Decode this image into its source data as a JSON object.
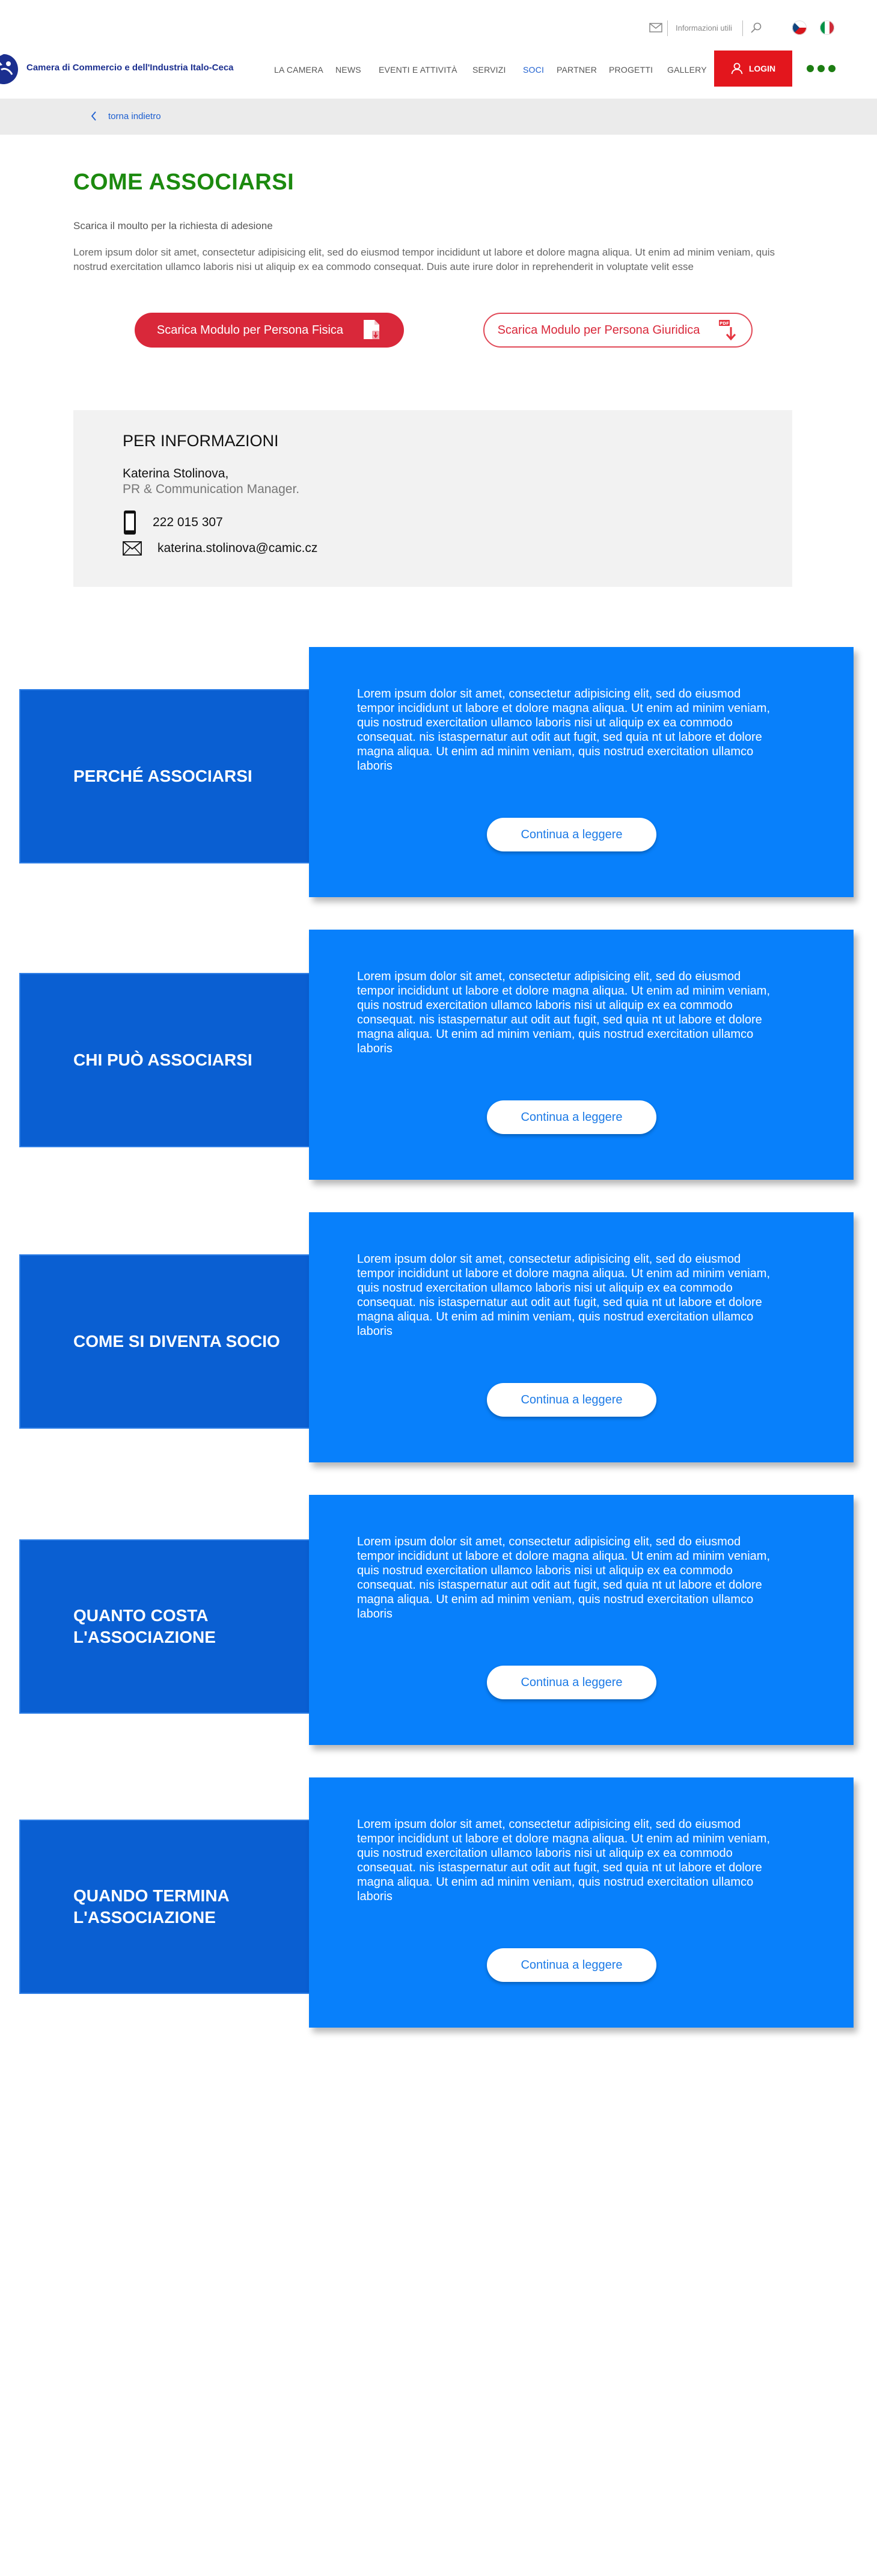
{
  "utility": {
    "info_label": "Informazioni utili",
    "icons": [
      "mail-icon",
      "search-icon",
      "flag-cz-icon",
      "flag-it-icon"
    ]
  },
  "header": {
    "org_name": "Camera di Commercio e dell'Industria Italo-Ceca",
    "nav": [
      "LA CAMERA",
      "NEWS",
      "EVENTI E ATTIVITÀ",
      "SERVIZI",
      "SOCI",
      "PARTNER",
      "PROGETTI",
      "GALLERY"
    ],
    "active_nav": "SOCI",
    "login_label": "LOGIN"
  },
  "breadcrumb": {
    "back_label": "torna indietro"
  },
  "intro": {
    "title": "COME ASSOCIARSI",
    "subtitle": "Scarica il moulto per la richiesta di adesione",
    "body": "Lorem ipsum dolor sit amet, consectetur adipisicing elit, sed do eiusmod tempor incididunt ut labore et dolore magna aliqua. Ut enim ad minim veniam, quis nostrud exercitation ullamco laboris nisi ut aliquip ex ea commodo consequat. Duis aute irure dolor in reprehenderit in voluptate velit esse",
    "download_fisica": "Scarica Modulo per Persona Fisica",
    "download_giuridica": "Scarica Modulo per Persona Giuridica"
  },
  "contact": {
    "title": "PER INFORMAZIONI",
    "name": "Katerina Stolinova,",
    "role": "PR & Communication Manager.",
    "phone": "222 015 307",
    "email": "katerina.stolinova@camic.cz"
  },
  "sections": [
    {
      "label": "PERCHÉ ASSOCIARSI",
      "text": "Lorem ipsum dolor sit amet, consectetur adipisicing elit, sed do eiusmod tempor incididunt ut labore et dolore magna aliqua. Ut enim ad minim veniam, quis nostrud exercitation ullamco laboris nisi ut aliquip ex ea commodo consequat. nis istaspernatur aut odit aut fugit, sed quia nt ut labore et dolore magna aliqua. Ut enim ad minim veniam, quis nostrud exercitation ullamco laboris",
      "button": "Continua a leggere"
    },
    {
      "label": "CHI PUÒ ASSOCIARSI",
      "text": "Lorem ipsum dolor sit amet, consectetur adipisicing elit, sed do eiusmod tempor incididunt ut labore et dolore magna aliqua. Ut enim ad minim veniam, quis nostrud exercitation ullamco laboris nisi ut aliquip ex ea commodo consequat. nis istaspernatur aut odit aut fugit, sed quia nt ut labore et dolore magna aliqua. Ut enim ad minim veniam, quis nostrud exercitation ullamco laboris",
      "button": "Continua a leggere"
    },
    {
      "label": "COME SI DIVENTA SOCIO",
      "text": "Lorem ipsum dolor sit amet, consectetur adipisicing elit, sed do eiusmod tempor incididunt ut labore et dolore magna aliqua. Ut enim ad minim veniam, quis nostrud exercitation ullamco laboris nisi ut aliquip ex ea commodo consequat. nis istaspernatur aut odit aut fugit, sed quia nt ut labore et dolore magna aliqua. Ut enim ad minim veniam, quis nostrud exercitation ullamco laboris",
      "button": "Continua a leggere"
    },
    {
      "label": "QUANTO COSTA L'ASSOCIAZIONE",
      "text": "Lorem ipsum dolor sit amet, consectetur adipisicing elit, sed do eiusmod tempor incididunt ut labore et dolore magna aliqua. Ut enim ad minim veniam, quis nostrud exercitation ullamco laboris nisi ut aliquip ex ea commodo consequat. nis istaspernatur aut odit aut fugit, sed quia nt ut labore et dolore magna aliqua. Ut enim ad minim veniam, quis nostrud exercitation ullamco laboris",
      "button": "Continua a leggere"
    },
    {
      "label": "QUANDO TERMINA L'ASSOCIAZIONE",
      "text": "Lorem ipsum dolor sit amet, consectetur adipisicing elit, sed do eiusmod tempor incididunt ut labore et dolore magna aliqua. Ut enim ad minim veniam, quis nostrud exercitation ullamco laboris nisi ut aliquip ex ea commodo consequat. nis istaspernatur aut odit aut fugit, sed quia nt ut labore et dolore magna aliqua. Ut enim ad minim veniam, quis nostrud exercitation ullamco laboris",
      "button": "Continua a leggere"
    }
  ],
  "colors": {
    "title_green": "#1c8a0f",
    "login_red": "#e3161d",
    "download_red": "#d9283a",
    "label_blue": "#0a5fd2",
    "card_blue": "#0880fb",
    "active_nav_blue": "#1d5fd0"
  }
}
